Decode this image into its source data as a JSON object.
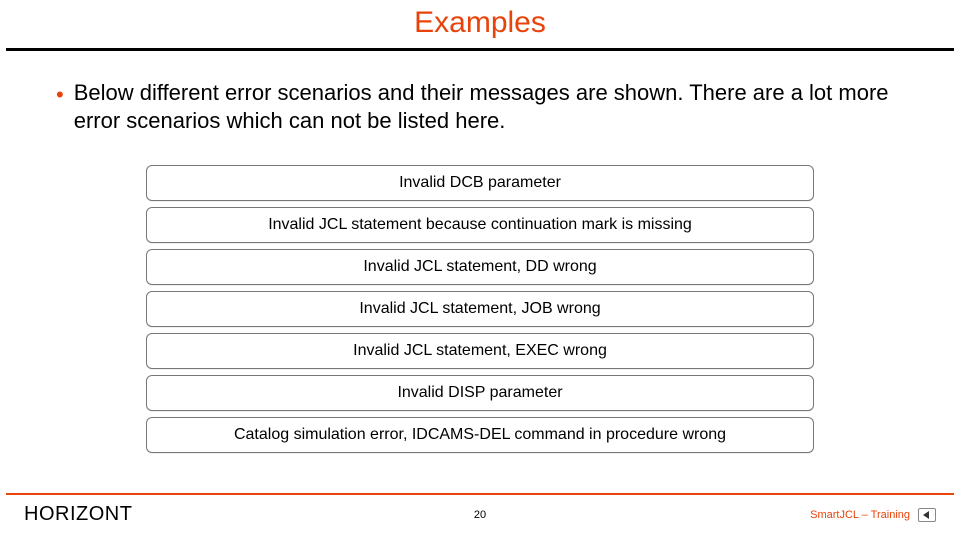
{
  "title": "Examples",
  "bullet": "Below different error scenarios and their messages are shown. There are a lot more error scenarios which can not be listed here.",
  "items": [
    "Invalid DCB parameter",
    "Invalid JCL statement because continuation mark is missing",
    "Invalid JCL statement, DD wrong",
    "Invalid JCL statement, JOB wrong",
    "Invalid JCL statement, EXEC wrong",
    "Invalid DISP parameter",
    "Catalog simulation error, IDCAMS-DEL command in procedure wrong"
  ],
  "footer": {
    "brand": "HORIZONT",
    "page": "20",
    "course": "SmartJCL – Training"
  },
  "colors": {
    "accent": "#e8430a"
  }
}
